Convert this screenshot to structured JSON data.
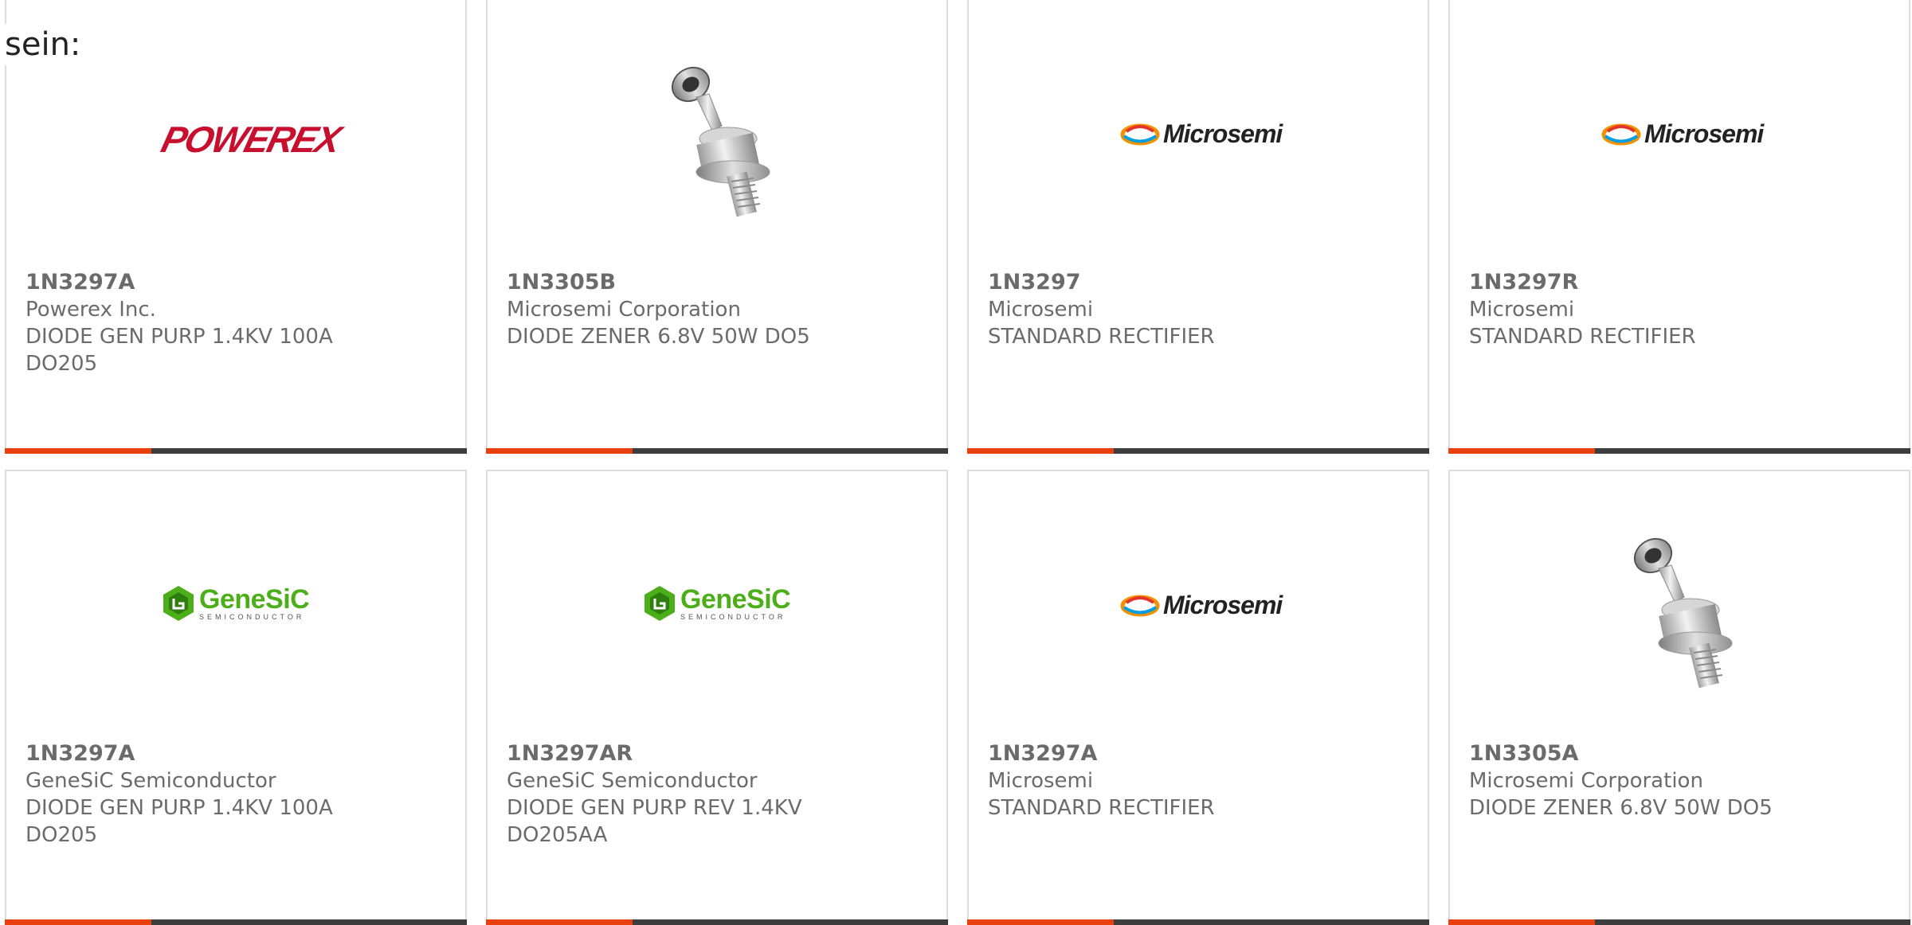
{
  "intro": {
    "text": "sein:"
  },
  "logo_texts": {
    "powerex": "POWEREX",
    "microsemi": "Microsemi",
    "genesic": "GeneSiC",
    "genesic_sub": "SEMICONDUCTOR"
  },
  "colors": {
    "accent": "#e8410f",
    "bar_dark": "#3d3d3d",
    "powerex_red": "#c8102e",
    "genesic_green": "#4caf1a",
    "text_gray": "#6b6b6b"
  },
  "products": [
    {
      "image": "powerex-logo",
      "part": "1N3297A",
      "maker": "Powerex Inc.",
      "desc1": "DIODE GEN PURP 1.4KV 100A",
      "desc2": "DO205"
    },
    {
      "image": "diode-photo",
      "part": "1N3305B",
      "maker": "Microsemi Corporation",
      "desc1": "DIODE ZENER 6.8V 50W DO5",
      "desc2": ""
    },
    {
      "image": "microsemi-logo",
      "part": "1N3297",
      "maker": "Microsemi",
      "desc1": "STANDARD RECTIFIER",
      "desc2": ""
    },
    {
      "image": "microsemi-logo",
      "part": "1N3297R",
      "maker": "Microsemi",
      "desc1": "STANDARD RECTIFIER",
      "desc2": ""
    },
    {
      "image": "genesic-logo",
      "part": "1N3297A",
      "maker": "GeneSiC Semiconductor",
      "desc1": "DIODE GEN PURP 1.4KV 100A",
      "desc2": "DO205"
    },
    {
      "image": "genesic-logo",
      "part": "1N3297AR",
      "maker": "GeneSiC Semiconductor",
      "desc1": "DIODE GEN PURP REV 1.4KV",
      "desc2": "DO205AA"
    },
    {
      "image": "microsemi-logo",
      "part": "1N3297A",
      "maker": "Microsemi",
      "desc1": "STANDARD RECTIFIER",
      "desc2": ""
    },
    {
      "image": "diode-photo",
      "part": "1N3305A",
      "maker": "Microsemi Corporation",
      "desc1": "DIODE ZENER 6.8V 50W DO5",
      "desc2": ""
    }
  ]
}
